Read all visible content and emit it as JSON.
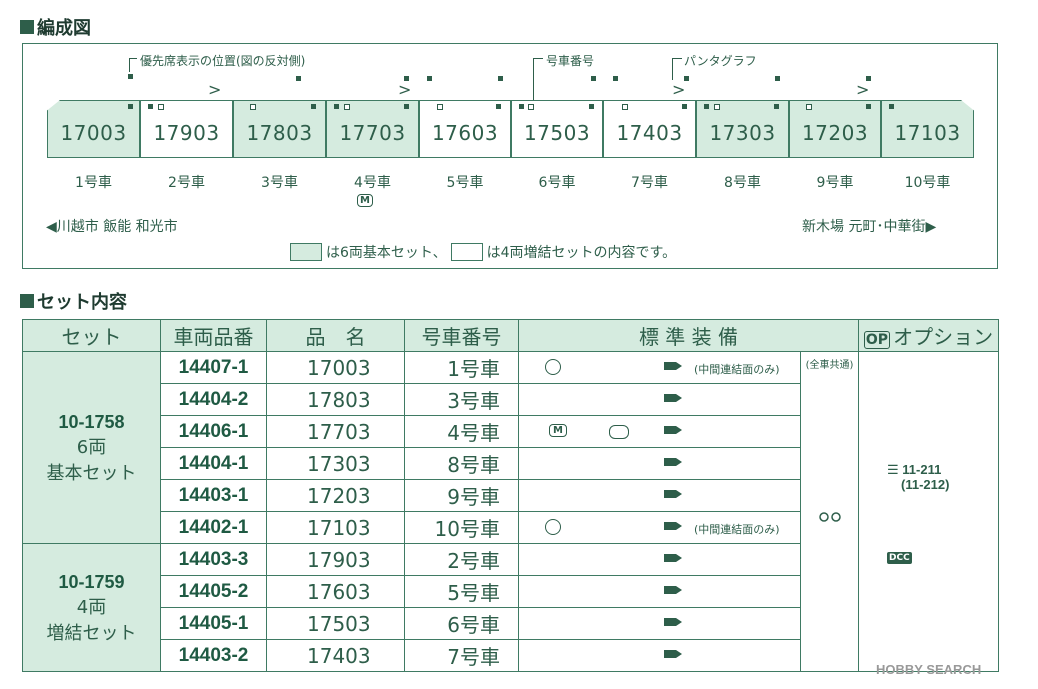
{
  "section1_title": "編成図",
  "callouts": {
    "priority_seat": "優先席表示の位置(図の反対側)",
    "car_number": "号車番号",
    "pantograph": "パンタグラフ"
  },
  "cars": [
    {
      "number": "17003",
      "label": "1号車",
      "basic": true
    },
    {
      "number": "17903",
      "label": "2号車",
      "basic": false
    },
    {
      "number": "17803",
      "label": "3号車",
      "basic": true
    },
    {
      "number": "17703",
      "label": "4号車",
      "basic": true
    },
    {
      "number": "17603",
      "label": "5号車",
      "basic": false
    },
    {
      "number": "17503",
      "label": "6号車",
      "basic": false
    },
    {
      "number": "17403",
      "label": "7号車",
      "basic": false
    },
    {
      "number": "17303",
      "label": "8号車",
      "basic": true
    },
    {
      "number": "17203",
      "label": "9号車",
      "basic": true
    },
    {
      "number": "17103",
      "label": "10号車",
      "basic": true
    }
  ],
  "motor_mark": "M",
  "direction_left": "◀川越市 飯能 和光市",
  "direction_right": "新木場 元町･中華街▶",
  "legend_basic": "は6両基本セット、",
  "legend_add": "は4両増結セットの内容です。",
  "section2_title": "セット内容",
  "table_headers": {
    "set": "セット",
    "code": "車両品番",
    "name": "品　名",
    "carno": "号車番号",
    "equip": "標 準 装 備",
    "option": "オプション",
    "op_badge": "OP"
  },
  "sets": [
    {
      "number": "10-1758",
      "cars_count": "6両",
      "type": "基本セット"
    },
    {
      "number": "10-1759",
      "cars_count": "4両",
      "type": "増結セット"
    }
  ],
  "rows": [
    {
      "code": "14407-1",
      "name": "17003",
      "carno": "1号車",
      "light": true,
      "note": "(中間連結面のみ)"
    },
    {
      "code": "14404-2",
      "name": "17803",
      "carno": "3号車"
    },
    {
      "code": "14406-1",
      "name": "17703",
      "carno": "4号車",
      "motor": "M"
    },
    {
      "code": "14404-1",
      "name": "17303",
      "carno": "8号車"
    },
    {
      "code": "14403-1",
      "name": "17203",
      "carno": "9号車"
    },
    {
      "code": "14402-1",
      "name": "17103",
      "carno": "10号車",
      "light": true,
      "note": "(中間連結面のみ)"
    },
    {
      "code": "14403-3",
      "name": "17903",
      "carno": "2号車"
    },
    {
      "code": "14405-2",
      "name": "17603",
      "carno": "5号車"
    },
    {
      "code": "14405-1",
      "name": "17503",
      "carno": "6号車"
    },
    {
      "code": "14403-2",
      "name": "17403",
      "carno": "7号車"
    }
  ],
  "common_note": "(全車共通)",
  "option_codes": {
    "line1": "11-211",
    "line2": "(11-212)"
  },
  "dcc_label": "DCC",
  "watermark": "HOBBY SEARCH",
  "colors": {
    "accent": "#2e5e4a",
    "basic_fill": "#d5ebdf"
  }
}
